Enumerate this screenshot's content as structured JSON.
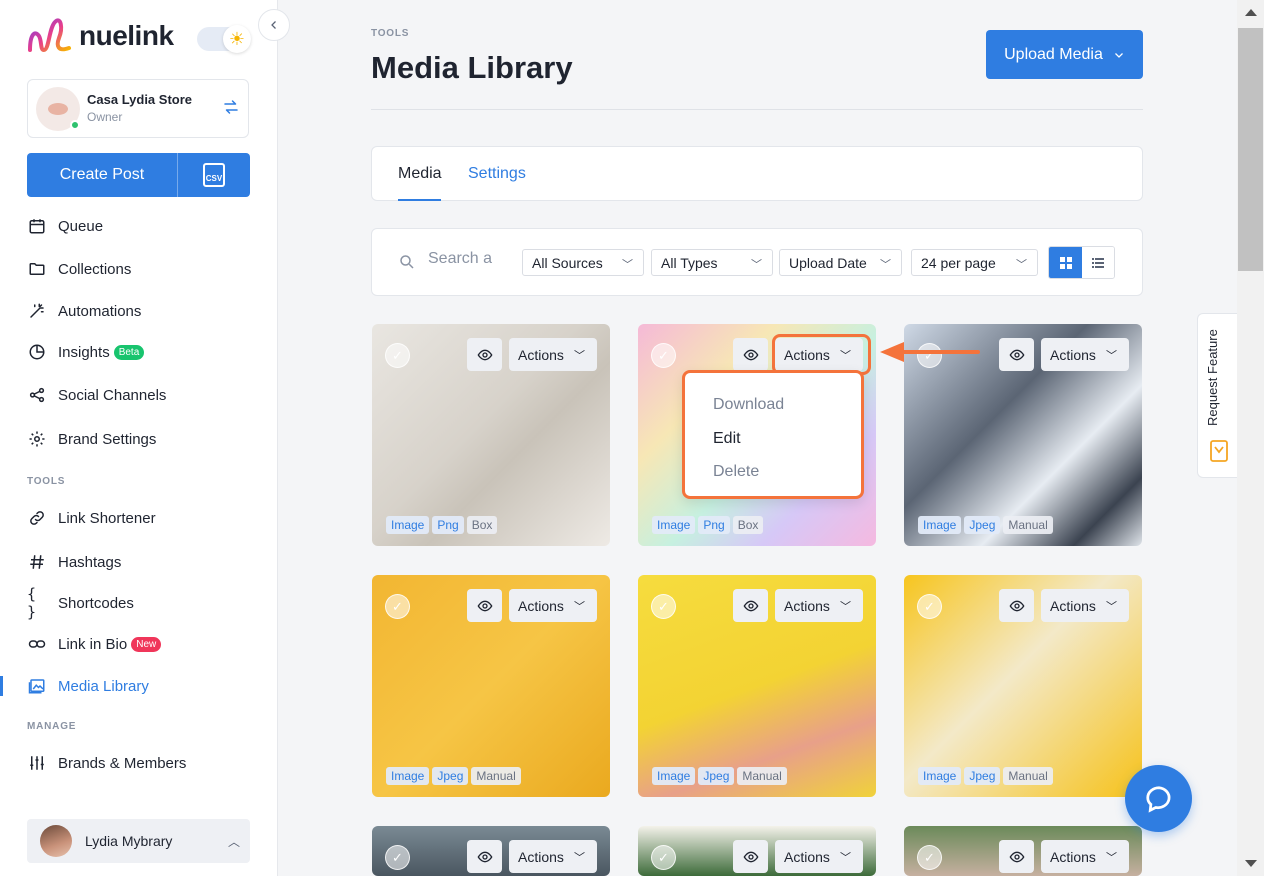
{
  "brand": {
    "logo_text": "nuelink",
    "account_name": "Casa Lydia Store",
    "account_role": "Owner"
  },
  "sidebar": {
    "create_post_label": "Create Post",
    "csv_label": "CSV",
    "nav_items": [
      {
        "label": "Queue",
        "icon": "calendar-icon"
      },
      {
        "label": "Collections",
        "icon": "folder-icon"
      },
      {
        "label": "Automations",
        "icon": "magic-wand-icon"
      },
      {
        "label": "Insights",
        "icon": "pie-chart-icon",
        "badge": "Beta"
      },
      {
        "label": "Social Channels",
        "icon": "share-icon"
      },
      {
        "label": "Brand Settings",
        "icon": "gear-icon"
      }
    ],
    "tools_label": "TOOLS",
    "tools_items": [
      {
        "label": "Link Shortener",
        "icon": "link-icon"
      },
      {
        "label": "Hashtags",
        "icon": "hash-icon"
      },
      {
        "label": "Shortcodes",
        "icon": "braces-icon"
      },
      {
        "label": "Link in Bio",
        "icon": "chain-icon",
        "badge": "New"
      },
      {
        "label": "Media Library",
        "icon": "image-icon",
        "active": true
      }
    ],
    "manage_label": "MANAGE",
    "manage_items": [
      {
        "label": "Brands & Members",
        "icon": "sliders-icon"
      }
    ],
    "user_name": "Lydia Mybrary"
  },
  "header": {
    "breadcrumb": "TOOLS",
    "title": "Media Library",
    "upload_button": "Upload Media"
  },
  "tabs": [
    {
      "label": "Media",
      "active": true
    },
    {
      "label": "Settings",
      "active": false
    }
  ],
  "filters": {
    "search_placeholder": "Search a",
    "sources": "All Sources",
    "types": "All Types",
    "sort": "Upload Date",
    "per_page": "24 per page"
  },
  "card_controls": {
    "actions_label": "Actions"
  },
  "media_cards": [
    {
      "tags": [
        "Image",
        "Png",
        "Box"
      ],
      "scene": "living-room"
    },
    {
      "tags": [
        "Image",
        "Png",
        "Box"
      ],
      "scene": "holographic"
    },
    {
      "tags": [
        "Image",
        "Jpeg",
        "Manual"
      ],
      "scene": "business-meeting"
    },
    {
      "tags": [
        "Image",
        "Jpeg",
        "Manual"
      ],
      "scene": "sunglasses-flat-lay"
    },
    {
      "tags": [
        "Image",
        "Jpeg",
        "Manual"
      ],
      "scene": "dog-painting"
    },
    {
      "tags": [
        "Image",
        "Jpeg",
        "Manual"
      ],
      "scene": "lemon-cosmetics"
    },
    {
      "tags": [],
      "scene": "city"
    },
    {
      "tags": [],
      "scene": "palms"
    },
    {
      "tags": [],
      "scene": "garden"
    }
  ],
  "actions_menu": {
    "items": [
      "Download",
      "Edit",
      "Delete"
    ]
  },
  "request_feature": "Request Feature",
  "colors": {
    "primary": "#2f7de1",
    "highlight": "#f4733b",
    "beta_badge": "#18c46e",
    "new_badge": "#f0365a"
  }
}
